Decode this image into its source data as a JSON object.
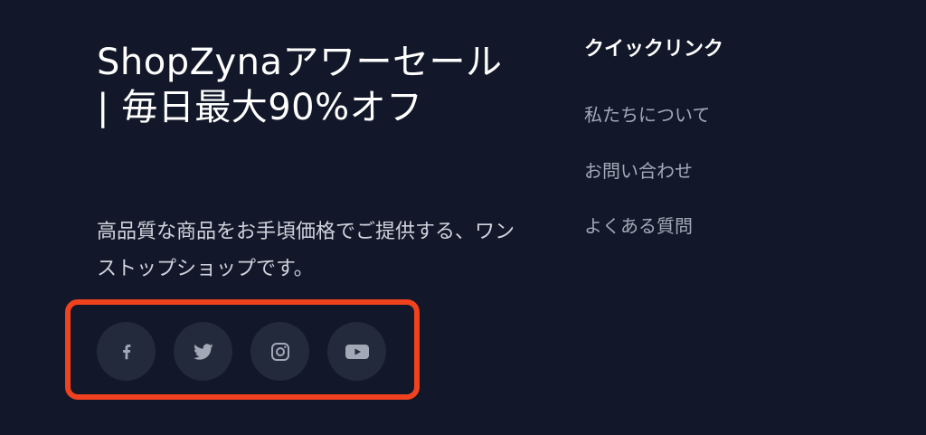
{
  "brand": {
    "headline": "ShopZynaアワーセール | 毎日最大90%オフ",
    "tagline": "高品質な商品をお手頃価格でご提供する、ワンストップショップです。"
  },
  "social": {
    "buttons": [
      {
        "icon": "facebook-icon"
      },
      {
        "icon": "twitter-icon"
      },
      {
        "icon": "instagram-icon"
      },
      {
        "icon": "youtube-icon"
      }
    ],
    "icon_color": "#a3a8b6",
    "button_bg": "#232a3b",
    "highlight_color": "#f0421e"
  },
  "quick_links": {
    "heading": "クイックリンク",
    "items": [
      {
        "label": "私たちについて"
      },
      {
        "label": "お問い合わせ"
      },
      {
        "label": "よくある質問"
      }
    ]
  },
  "colors": {
    "background": "#121829",
    "text_primary": "#ffffff",
    "text_secondary": "#cfd3dc",
    "link_text": "#a3a8b6"
  }
}
